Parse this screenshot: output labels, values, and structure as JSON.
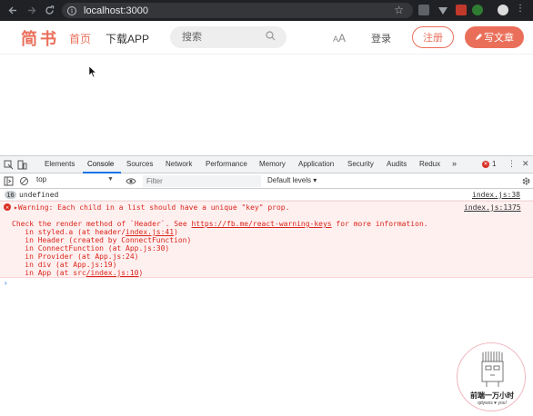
{
  "browser": {
    "url": "localhost:3000",
    "back_icon": "arrow-left-icon",
    "forward_icon": "arrow-right-icon",
    "reload_icon": "reload-icon",
    "info_icon": "info-icon",
    "info_glyph": "i"
  },
  "header": {
    "logo": "简书",
    "nav_home": "首页",
    "nav_app": "下载APP",
    "search_placeholder": "搜索",
    "font_toggle_big": "A",
    "font_toggle_small": "A",
    "login": "登录",
    "register": "注册",
    "write": "写文章",
    "accent_color": "#ea6f5a"
  },
  "devtools": {
    "tabs": [
      "Elements",
      "Console",
      "Sources",
      "Network",
      "Performance",
      "Memory",
      "Application",
      "Security",
      "Audits",
      "Redux"
    ],
    "active_tab": "Console",
    "more_tabs": "»",
    "error_count": "1",
    "error_glyph": "✕",
    "context": "top",
    "filter_placeholder": "Filter",
    "levels": "Default levels ▾",
    "log_badge": "16",
    "log_message": "undefined",
    "log_source": "index.js:38",
    "error": {
      "line1": "▸Warning: Each child in a list should have a unique \"key\" prop.",
      "source": "index.js:1375",
      "line2_prefix": "Check the render method of `Header`. See ",
      "line2_link": "https://fb.me/react-warning-keys",
      "line2_suffix": " for more information.",
      "stack": [
        {
          "text": "    in styled.a (at header/",
          "link": "index.js:41",
          "tail": ")"
        },
        {
          "text": "    in Header (created by ConnectFunction)",
          "link": "",
          "tail": ""
        },
        {
          "text": "    in ConnectFunction (at App.js:30)",
          "link": "",
          "tail": ""
        },
        {
          "text": "    in Provider (at App.js:24)",
          "link": "",
          "tail": ""
        },
        {
          "text": "    in div (at App.js:19)",
          "link": "",
          "tail": ""
        },
        {
          "text": "    in App (at src",
          "link": "/index.js:10",
          "tail": ")"
        }
      ]
    },
    "prompt": "›"
  },
  "watermark": {
    "title": "前端一万小时",
    "subtitle": "qdywxs ♥ you!"
  }
}
